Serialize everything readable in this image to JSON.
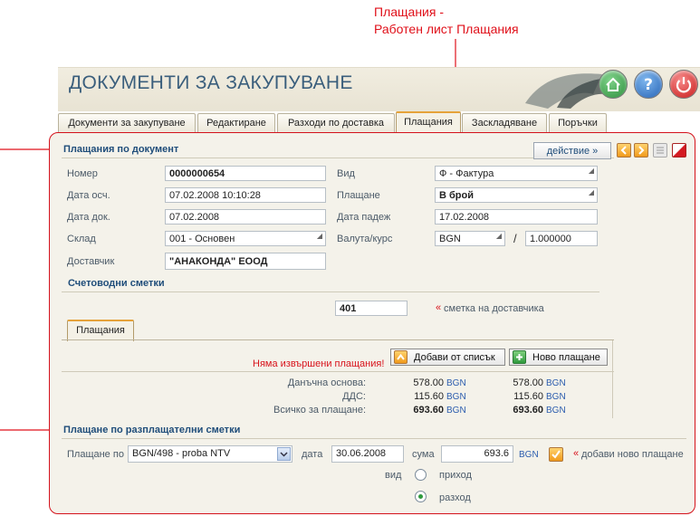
{
  "annotations": {
    "top_line1": "Плащания -",
    "top_line2": "Работен лист Плащания"
  },
  "header": {
    "title": "ДОКУМЕНТИ ЗА ЗАКУПУВАНЕ"
  },
  "tabs": [
    "Документи за закупуване",
    "Редактиране",
    "Разходи по доставка",
    "Плащания",
    "Заскладяване",
    "Поръчки"
  ],
  "document": {
    "title": "Плащания по документ",
    "action_label": "действие »",
    "fields": {
      "number_label": "Номер",
      "number_value": "0000000654",
      "date_acc_label": "Дата осч.",
      "date_acc_value": "07.02.2008 10:10:28",
      "date_doc_label": "Дата док.",
      "date_doc_value": "07.02.2008",
      "warehouse_label": "Склад",
      "warehouse_value": "001 - Основен",
      "supplier_label": "Доставчик",
      "supplier_value": "\"АНАКОНДА\" ЕООД",
      "type_label": "Вид",
      "type_value": "Ф - Фактура",
      "payment_label": "Плащане",
      "payment_value": "В брой",
      "due_label": "Дата падеж",
      "due_value": "17.02.2008",
      "currency_label": "Валута/курс",
      "currency_value": "BGN",
      "rate_value": "1.000000"
    }
  },
  "accounts": {
    "title": "Счетоводни сметки",
    "account_value": "401",
    "account_note_mark": "«",
    "account_note": "сметка на доставчика"
  },
  "payments_tab": {
    "tab_label": "Плащания",
    "no_payments": "Няма извършени плащания!",
    "add_from_list": "Добави от списък",
    "new_payment": "Ново плащане"
  },
  "totals": {
    "currency": "BGN",
    "rows": [
      {
        "label": "Данъчна основа:",
        "v1": "578.00",
        "v2": "578.00"
      },
      {
        "label": "ДДС:",
        "v1": "115.60",
        "v2": "115.60"
      },
      {
        "label": "Всичко за плащане:",
        "v1": "693.60",
        "v2": "693.60"
      }
    ]
  },
  "settlement": {
    "title": "Плащане по разплащателни сметки",
    "pay_by_label": "Плащане по",
    "account_select": "BGN/498 - proba NTV",
    "date_label": "дата",
    "date_value": "30.06.2008",
    "sum_label": "сума",
    "sum_value": "693.6",
    "currency": "BGN",
    "add_mark": "«",
    "add_label": "добави ново плащане",
    "kind_label": "вид",
    "option_income": "приход",
    "option_expense": "разход",
    "selected": "разход"
  },
  "colors": {
    "annotation": "#e0101a",
    "title_blue": "#3a5e7c",
    "section_blue": "#1f4d7a",
    "bgn_blue": "#2c5dae"
  }
}
